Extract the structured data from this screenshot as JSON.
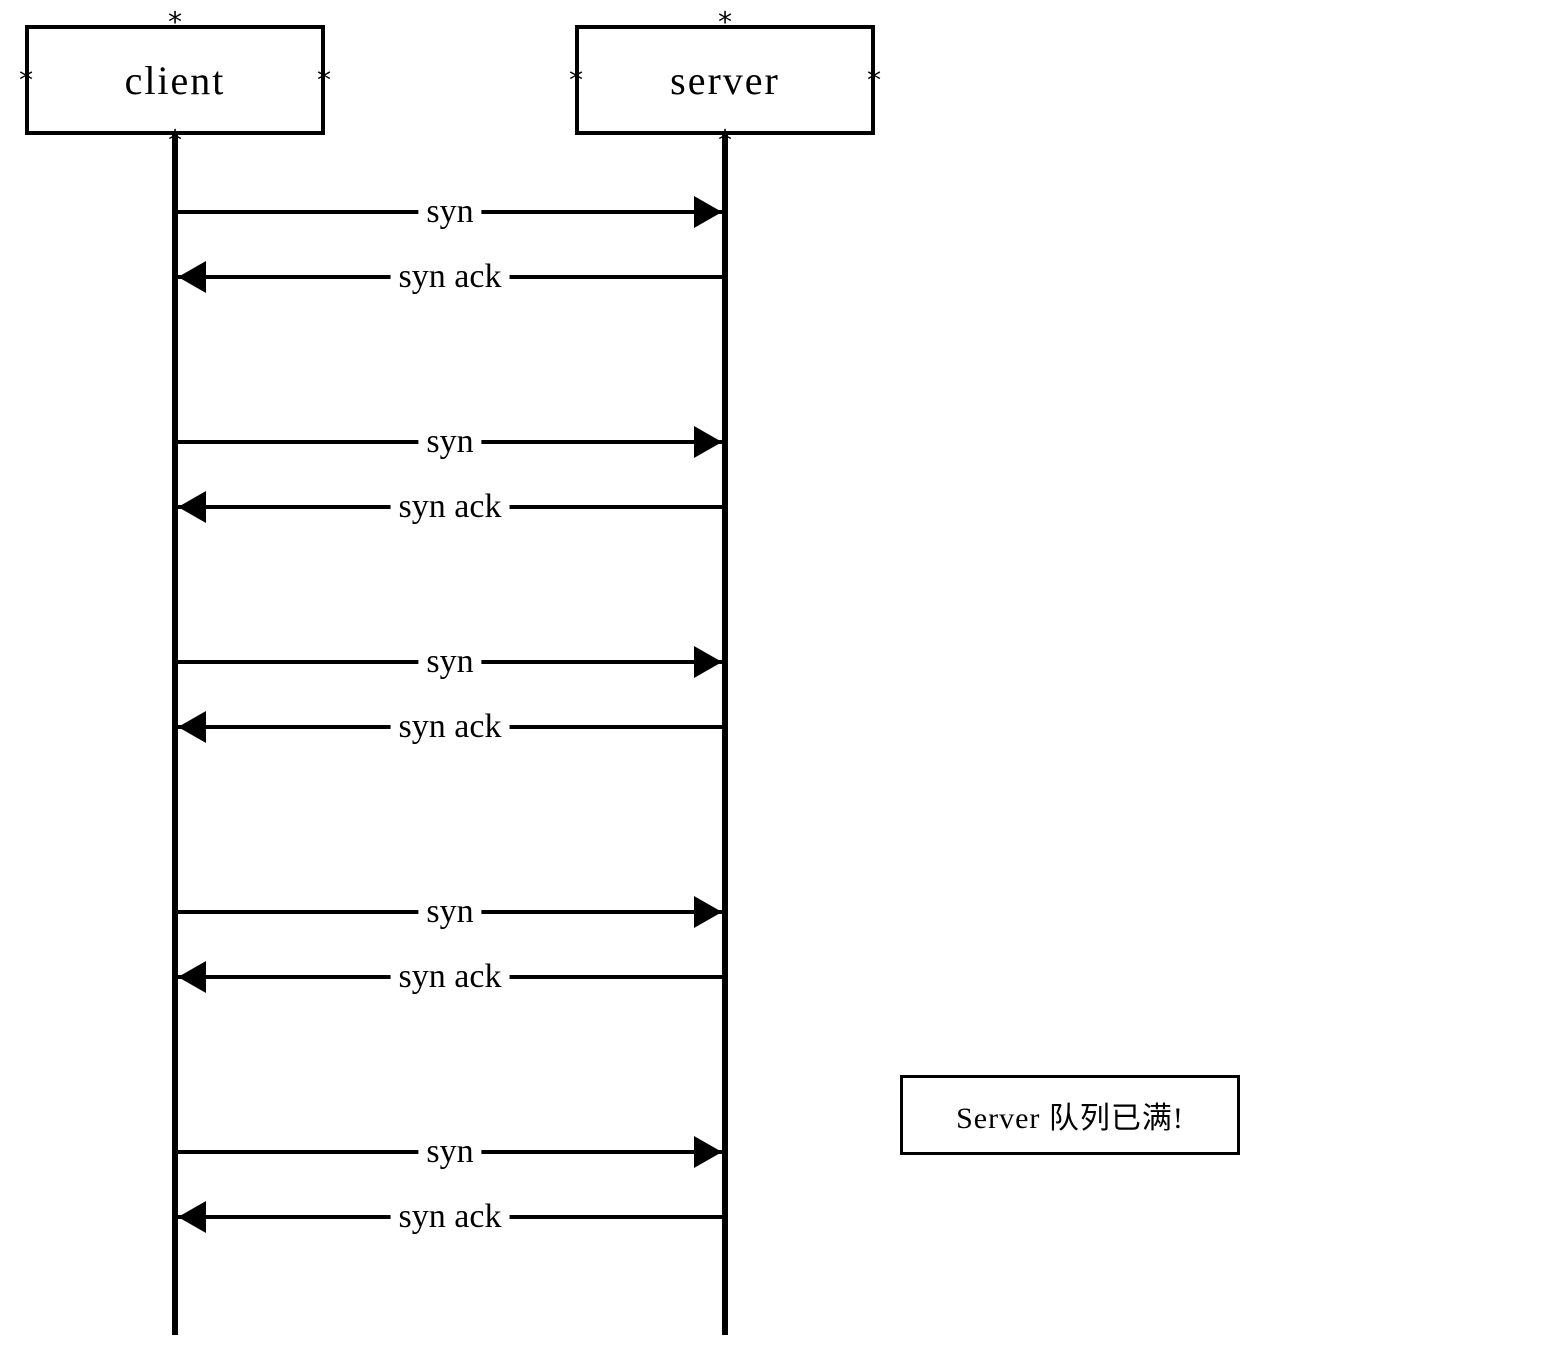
{
  "participants": {
    "client": {
      "label": "client"
    },
    "server": {
      "label": "server"
    }
  },
  "messages": [
    {
      "label": "syn",
      "dir": "right"
    },
    {
      "label": "syn ack",
      "dir": "left"
    },
    {
      "label": "syn",
      "dir": "right"
    },
    {
      "label": "syn ack",
      "dir": "left"
    },
    {
      "label": "syn",
      "dir": "right"
    },
    {
      "label": "syn ack",
      "dir": "left"
    },
    {
      "label": "syn",
      "dir": "right"
    },
    {
      "label": "syn ack",
      "dir": "left"
    },
    {
      "label": "syn",
      "dir": "right"
    },
    {
      "label": "syn ack",
      "dir": "left"
    }
  ],
  "note": {
    "text": "Server 队列已满!"
  },
  "chart_data": {
    "type": "sequence-diagram",
    "participants": [
      "client",
      "server"
    ],
    "interactions": [
      {
        "from": "client",
        "to": "server",
        "message": "syn"
      },
      {
        "from": "server",
        "to": "client",
        "message": "syn ack"
      },
      {
        "from": "client",
        "to": "server",
        "message": "syn"
      },
      {
        "from": "server",
        "to": "client",
        "message": "syn ack"
      },
      {
        "from": "client",
        "to": "server",
        "message": "syn"
      },
      {
        "from": "server",
        "to": "client",
        "message": "syn ack"
      },
      {
        "from": "client",
        "to": "server",
        "message": "syn"
      },
      {
        "from": "server",
        "to": "client",
        "message": "syn ack"
      },
      {
        "from": "client",
        "to": "server",
        "message": "syn"
      },
      {
        "from": "server",
        "to": "client",
        "message": "syn ack"
      }
    ],
    "note": {
      "attached_to": "server",
      "text": "Server 队列已满!"
    }
  }
}
